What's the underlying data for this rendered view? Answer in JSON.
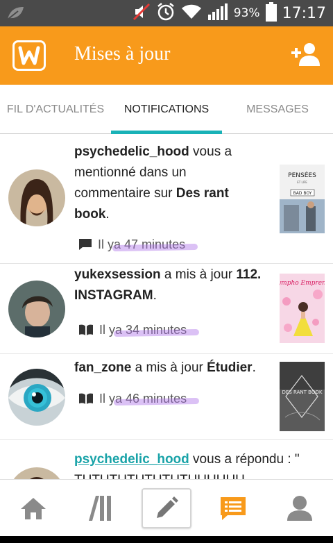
{
  "status_bar": {
    "battery_percent": "93%",
    "time": "17:17",
    "icons": [
      "leaf-icon",
      "mute-icon",
      "alarm-icon",
      "wifi-icon",
      "signal-icon",
      "battery-icon"
    ]
  },
  "app_bar": {
    "title": "Mises à jour",
    "logo_letter": "w",
    "colors": {
      "brand": "#f89a1b",
      "accent": "#19b2b7"
    }
  },
  "tabs": [
    {
      "label": "FIL D'ACTUALITÉS",
      "active": false
    },
    {
      "label": "NOTIFICATIONS",
      "active": true
    },
    {
      "label": "MESSAGES",
      "active": false
    }
  ],
  "notifications": [
    {
      "username": "psychedelic_hood",
      "text1": " vous a mentionné dans un commentaire sur ",
      "bold": "Des rant book",
      "text2": ".",
      "time_prefix": "Il y ",
      "time": "a 47 minutes",
      "meta_icon": "comment-icon",
      "cover_title": "PENSÉES",
      "cover_sub": "BAD BOY",
      "cover_small": "ET LIFE"
    },
    {
      "username": "yukexsession",
      "text1": " a mis à jour ",
      "bold": "112. INSTAGRAM",
      "text2": ".",
      "time_prefix": "Il y ",
      "time": "a 34 minutes",
      "meta_icon": "book-icon",
      "cover_title": "Nympho Emprente"
    },
    {
      "username": "fan_zone",
      "text1": " a mis à jour ",
      "bold": "Étudier",
      "text2": ".",
      "time_prefix": "Il y ",
      "time": "a 46 minutes",
      "meta_icon": "book-icon",
      "cover_title": "DES RANT BOOK"
    },
    {
      "username": "psychedelic_hood",
      "text1": " vous a répondu : \"",
      "body": "TUTUTUTUTUTUTUUUUUU"
    }
  ],
  "bottom_nav": [
    "home-icon",
    "library-icon",
    "write-icon",
    "updates-icon",
    "profile-icon"
  ]
}
